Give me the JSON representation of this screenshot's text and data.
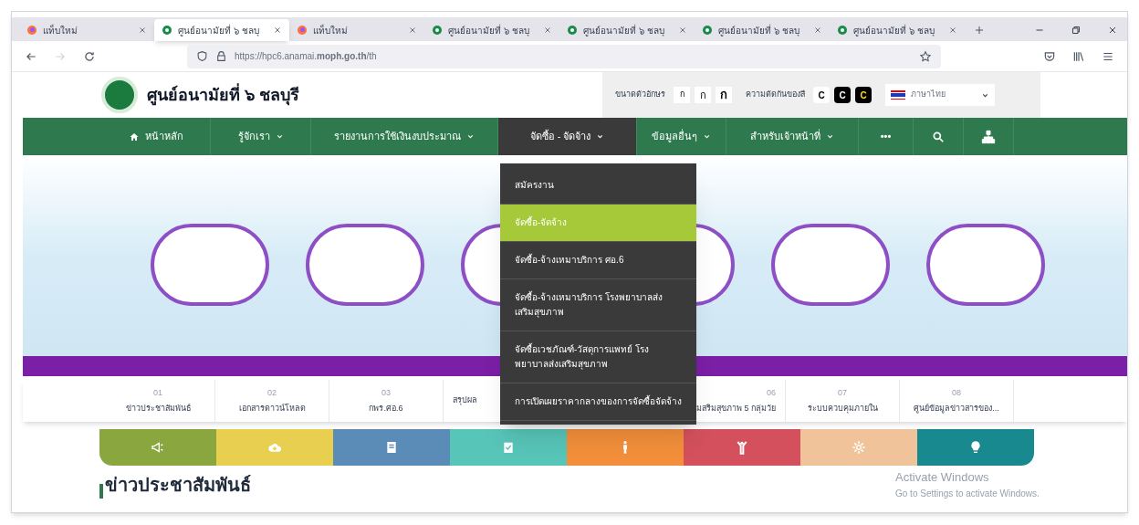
{
  "browser": {
    "tabs": [
      {
        "title": "แท็บใหม่",
        "kind": "newtab",
        "selected": false
      },
      {
        "title": "ศูนย์อนามัยที่ ๖ ชลบุ",
        "kind": "site",
        "selected": true
      },
      {
        "title": "แท็บใหม่",
        "kind": "newtab",
        "selected": false
      },
      {
        "title": "ศูนย์อนามัยที่ ๖ ชลบุ",
        "kind": "site",
        "selected": false
      },
      {
        "title": "ศูนย์อนามัยที่ ๖ ชลบุ",
        "kind": "site",
        "selected": false
      },
      {
        "title": "ศูนย์อนามัยที่ ๖ ชลบุ",
        "kind": "site",
        "selected": false
      },
      {
        "title": "ศูนย์อนามัยที่ ๖ ชลบุ",
        "kind": "site",
        "selected": false
      }
    ],
    "url": "https://hpc6.anamai.**moph.go.th**/th"
  },
  "site": {
    "title": "ศูนย์อนามัยที่ ๖ ชลบุรี",
    "font_size": {
      "label": "ขนาดตัวอักษร",
      "options": [
        "ก",
        "ก",
        "ก"
      ]
    },
    "contrast": {
      "label": "ความตัดกันของสี",
      "options": [
        {
          "text": "C",
          "kind": "normal"
        },
        {
          "text": "C",
          "kind": "white"
        },
        {
          "text": "C",
          "kind": "yellow"
        }
      ]
    },
    "language": "ภาษาไทย"
  },
  "nav": [
    {
      "label": "หน้าหลัก",
      "kind": "home",
      "selected": false
    },
    {
      "label": "รู้จักเรา",
      "kind": "menu",
      "selected": false
    },
    {
      "label": "รายงานการใช้เงินงบประมาณ",
      "kind": "menu",
      "selected": false
    },
    {
      "label": "จัดซื้อ - จัดจ้าง",
      "kind": "menu",
      "selected": true
    },
    {
      "label": "ข้อมูลอื่นๆ",
      "kind": "menu",
      "selected": false
    },
    {
      "label": "สำหรับเจ้าหน้าที่",
      "kind": "menu",
      "selected": false
    },
    {
      "label": "•••",
      "kind": "more",
      "selected": false
    },
    {
      "kind": "search",
      "selected": false
    },
    {
      "kind": "sitemap",
      "selected": false
    }
  ],
  "dropdown": [
    {
      "label": "สมัครงาน",
      "selected": false
    },
    {
      "label": "จัดซื้อ-จัดจ้าง",
      "selected": true
    },
    {
      "label": "จัดซื้อ-จ้างเหมาบริการ ศอ.6",
      "selected": false
    },
    {
      "label": "จัดซื้อ-จ้างเหมาบริการ โรงพยาบาลส่งเสริมสุขภาพ",
      "selected": false
    },
    {
      "label": "จัดซื้อเวชภัณฑ์-วัสดุการแพทย์ โรงพยาบาลส่งเสริมสุขภาพ",
      "selected": false
    },
    {
      "label": "การเปิดเผยราคากลางของการจัดซื้อจัดจ้าง",
      "selected": false
    }
  ],
  "shortcuts": [
    {
      "number": "01",
      "label": "ข่าวประชาสัมพันธ์"
    },
    {
      "number": "02",
      "label": "เอกสารดาวน์โหลด"
    },
    {
      "number": "03",
      "label": "กพร.ศอ.6"
    },
    {
      "label": "สรุปผล",
      "kind": "start"
    },
    {
      "number": "06",
      "label": "มสริมสุขภาพ 5 กลุ่มวัย",
      "kind": "end"
    },
    {
      "number": "07",
      "label": "ระบบควบคุมภายใน"
    },
    {
      "number": "08",
      "label": "ศูนย์ข้อมูลข่าวสารของ..."
    }
  ],
  "tiles": [
    {
      "kind": "megaphone",
      "color": "#8aa63e"
    },
    {
      "kind": "cloud",
      "color": "#e9cf4f"
    },
    {
      "kind": "book",
      "color": "#5b8cb8"
    },
    {
      "kind": "clipboard",
      "color": "#58c5b9"
    },
    {
      "kind": "person",
      "color": "#f38f3a"
    },
    {
      "kind": "cheer",
      "color": "#d3505c"
    },
    {
      "kind": "gear",
      "color": "#f0c39a"
    },
    {
      "kind": "bulb",
      "color": "#17898f"
    }
  ],
  "section_heading": "ข่าวประชาสัมพันธ์",
  "os_notice": {
    "title": "Activate Windows",
    "text": "Go to Settings to activate Windows."
  }
}
